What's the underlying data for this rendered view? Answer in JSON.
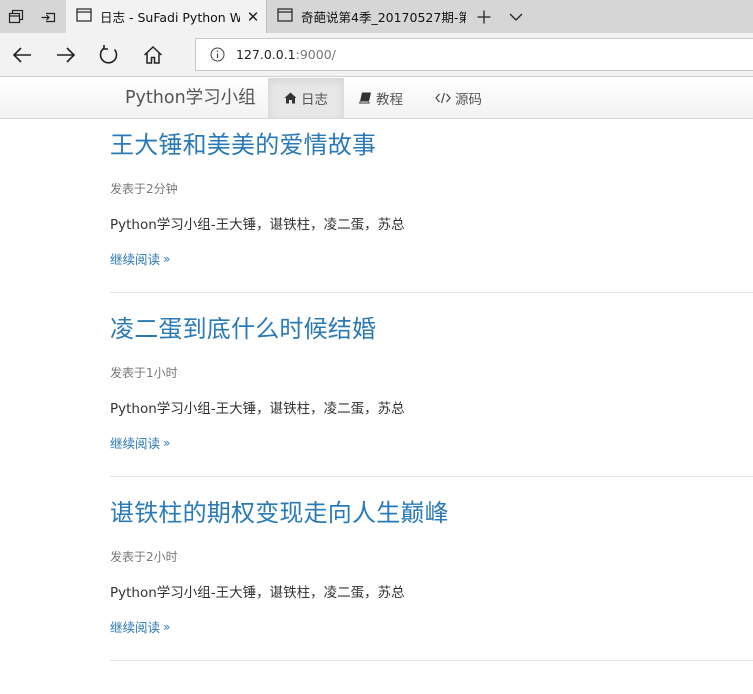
{
  "browser": {
    "tabs": [
      {
        "title": "日志 - SuFadi Python W",
        "active": true
      },
      {
        "title": "奇葩说第4季_20170527期-第",
        "active": false
      }
    ],
    "url": {
      "host": "127.0.0.1",
      "port": ":9000/"
    },
    "icons": [
      "tab-set-aside-icon",
      "tabs-preview-icon",
      "page-icon",
      "close-icon",
      "new-tab-plus-icon",
      "tab-list-chevron-icon",
      "back-arrow-icon",
      "forward-arrow-icon",
      "refresh-icon",
      "home-icon",
      "info-icon"
    ]
  },
  "site": {
    "brand": "Python学习小组",
    "nav": [
      {
        "label": "日志",
        "icon": "home-icon",
        "active": true
      },
      {
        "label": "教程",
        "icon": "book-icon",
        "active": false
      },
      {
        "label": "源码",
        "icon": "code-icon",
        "active": false
      }
    ]
  },
  "posts": [
    {
      "title": "王大锤和美美的爱情故事",
      "meta": "发表于2分钟",
      "summary": "Python学习小组-王大锤，谌铁柱，凌二蛋，苏总",
      "more": "继续阅读"
    },
    {
      "title": "凌二蛋到底什么时候结婚",
      "meta": "发表于1小时",
      "summary": "Python学习小组-王大锤，谌铁柱，凌二蛋，苏总",
      "more": "继续阅读"
    },
    {
      "title": "谌铁柱的期权变现走向人生巅峰",
      "meta": "发表于2小时",
      "summary": "Python学习小组-王大锤，谌铁柱，凌二蛋，苏总",
      "more": "继续阅读"
    }
  ],
  "colors": {
    "link": "#2a7ab8",
    "tabstrip": "#d6d6d6",
    "toolbar": "#f2f2f2"
  }
}
